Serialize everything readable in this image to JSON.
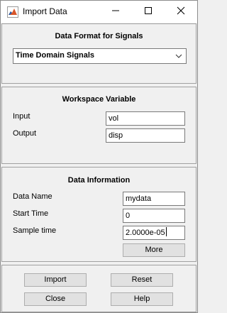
{
  "window": {
    "title": "Import Data",
    "icon": "matlab-icon"
  },
  "format_panel": {
    "title": "Data Format for Signals",
    "selected_format": "Time Domain Signals"
  },
  "workspace_panel": {
    "title": "Workspace Variable",
    "input_label": "Input",
    "input_value": "vol",
    "output_label": "Output",
    "output_value": "disp"
  },
  "info_panel": {
    "title": "Data Information",
    "name_label": "Data Name",
    "name_value": "mydata",
    "start_label": "Start Time",
    "start_value": "0",
    "sample_label": "Sample time",
    "sample_value": "2.0000e-05",
    "more_label": "More"
  },
  "actions": {
    "import_label": "Import",
    "reset_label": "Reset",
    "close_label": "Close",
    "help_label": "Help"
  }
}
